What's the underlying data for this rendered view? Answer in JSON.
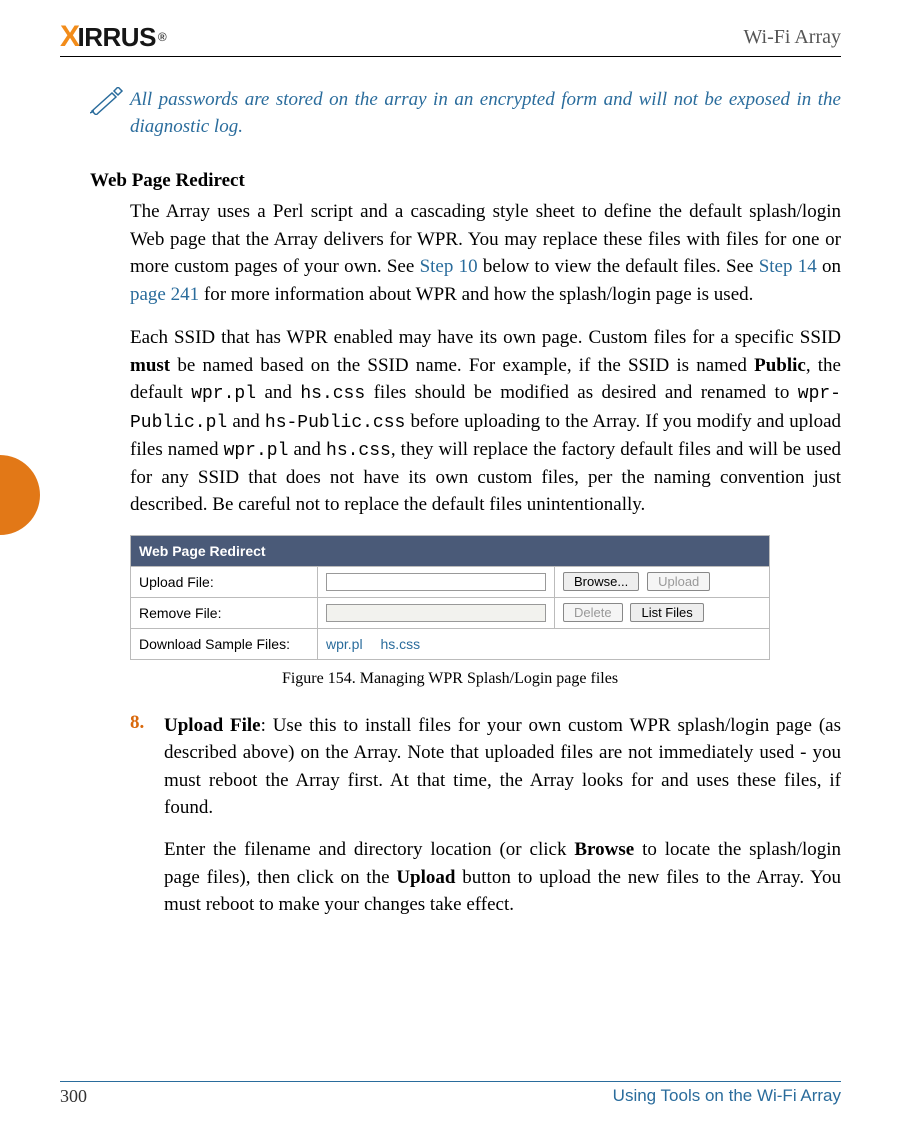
{
  "header": {
    "brand_x": "X",
    "brand_rest": "IRRUS",
    "brand_reg": "®",
    "product": "Wi-Fi Array"
  },
  "note": {
    "text": "All passwords are stored on the array in an encrypted form and will not be exposed in the diagnostic log."
  },
  "section": {
    "title": "Web Page Redirect"
  },
  "para1": {
    "t1": "The Array uses a Perl script and a cascading style sheet to define the default splash/login Web page that the Array delivers for WPR. You may replace these files with files for one or more custom pages of your own. See ",
    "link_step10": "Step 10",
    "t2": " below to view the default files. See ",
    "link_step14": "Step 14",
    "t3": " on ",
    "link_page241": "page 241",
    "t4": " for more information about WPR and how the splash/login page is used."
  },
  "para2": {
    "t1": "Each SSID that has WPR enabled may have its own page. Custom files for a specific SSID ",
    "b1": "must",
    "t2": " be named based on the SSID name. For example, if the SSID is named ",
    "b2": "Public",
    "t3": ", the default ",
    "m1": "wpr.pl",
    "t4": " and ",
    "m2": "hs.css",
    "t5": " files should be modified as desired and renamed to ",
    "m3": "wpr-Public.pl",
    "t6": " and ",
    "m4": "hs-Public.css",
    "t7": " before uploading to the Array. If you modify and upload files named ",
    "m5": "wpr.pl",
    "t8": " and ",
    "m6": "hs.css",
    "t9": ", they will replace the factory default files and will be used for any SSID that does not have its own custom files, per the naming convention just described. Be careful not to replace the default files unintentionally."
  },
  "figure": {
    "panel_title": "Web Page Redirect",
    "row1_label": "Upload File:",
    "row2_label": "Remove File:",
    "row3_label": "Download Sample Files:",
    "btn_browse": "Browse...",
    "btn_upload": "Upload",
    "btn_delete": "Delete",
    "btn_listfiles": "List Files",
    "sample1": "wpr.pl",
    "sample2": "hs.css",
    "caption": "Figure 154. Managing WPR Splash/Login page files"
  },
  "steps": {
    "s8": {
      "num": "8.",
      "b1": "Upload File",
      "t1": ": Use this to install files for your own custom WPR splash/login page (as described above) on the Array. Note that uploaded files are not immediately used - you must reboot the Array first. At that time, the Array looks for and uses these files, if found.",
      "t2a": "Enter the filename and directory location (or click ",
      "b2": "Browse",
      "t2b": " to locate the splash/login page files), then click on the ",
      "b3": "Upload",
      "t2c": " button to upload the new files to the Array. You must reboot to make your changes take effect."
    }
  },
  "footer": {
    "page": "300",
    "section": "Using Tools on the Wi-Fi Array"
  }
}
